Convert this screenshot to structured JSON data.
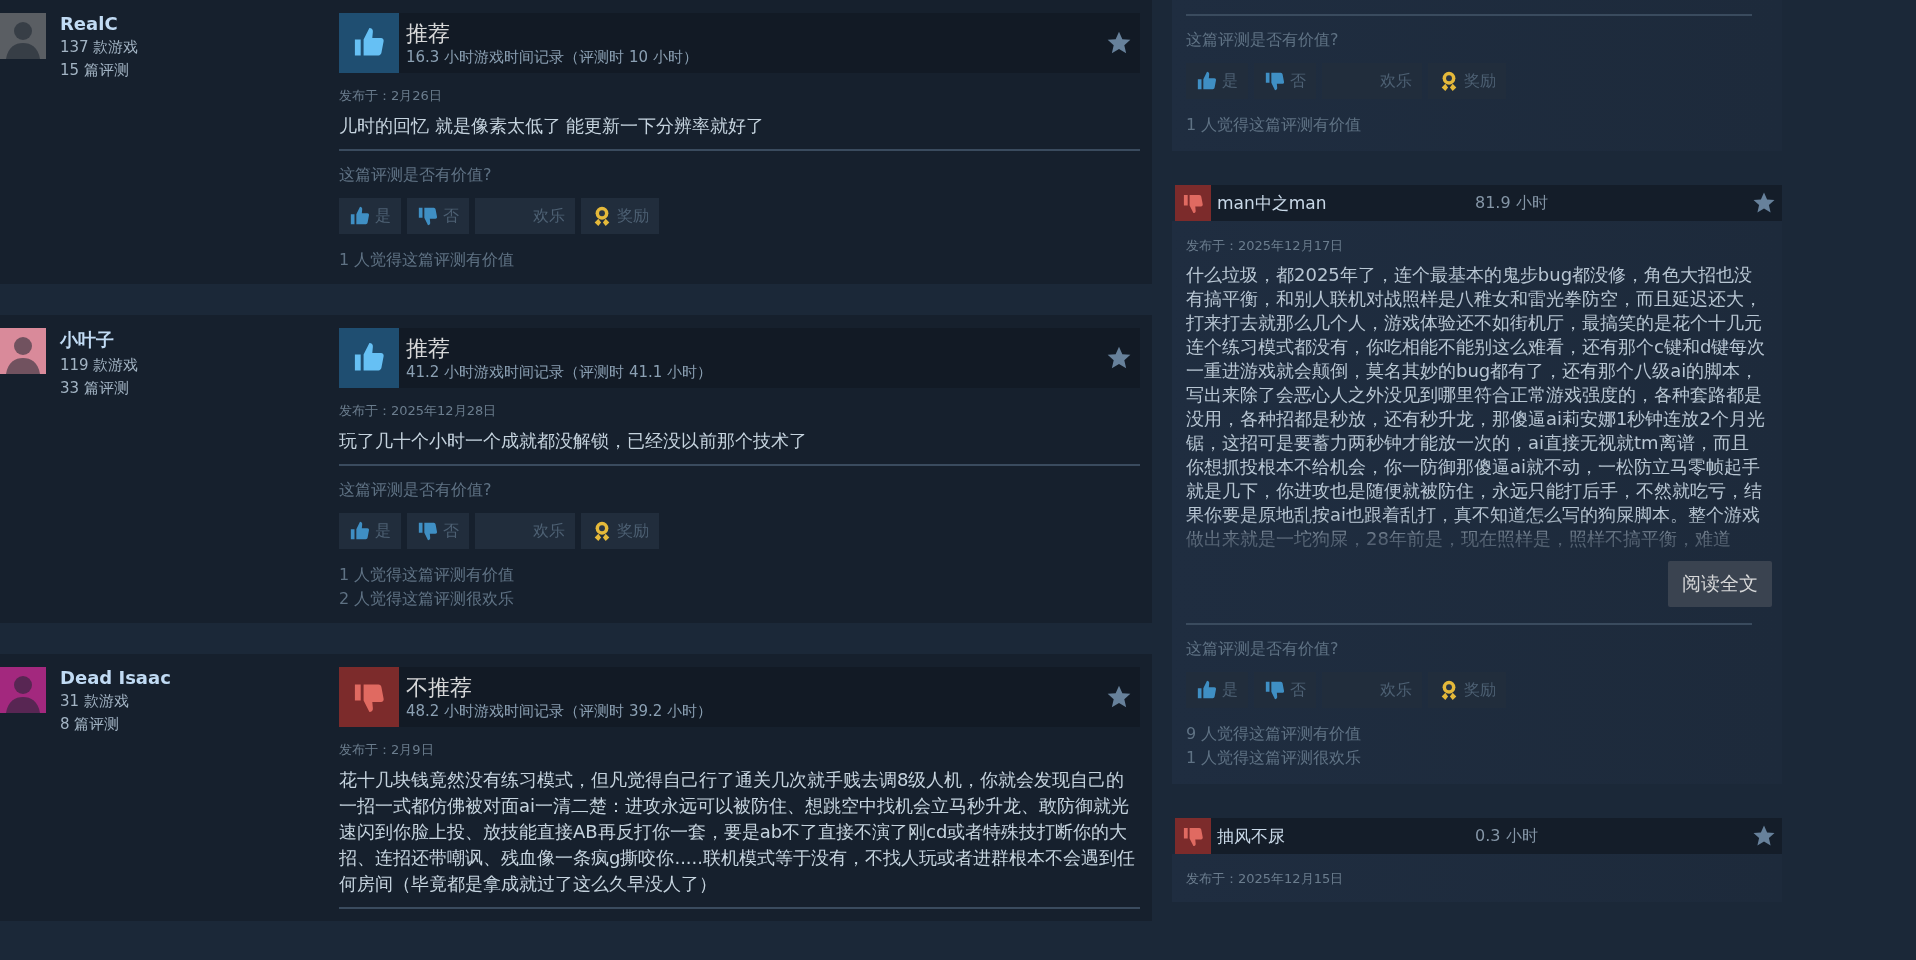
{
  "left_reviews": [
    {
      "user": {
        "name": "RealC",
        "games": "137 款游戏",
        "reviews": "15 篇评测",
        "color": "#5a5e63"
      },
      "recommended": true,
      "verdict": "推荐",
      "hours": "16.3 小时游戏时间记录（评测时 10 小时）",
      "posted": "发布于：2月26日",
      "body": "儿时的回忆 就是像素太低了 能更新一下分辨率就好了",
      "question": "这篇评测是否有价值?",
      "buttons": [
        {
          "kind": "yes",
          "label": "是"
        },
        {
          "kind": "no",
          "label": "否"
        },
        {
          "kind": "funny",
          "label": "欢乐"
        },
        {
          "kind": "award",
          "label": "奖励"
        }
      ],
      "counts": [
        "1 人觉得这篇评测有价值"
      ]
    },
    {
      "user": {
        "name": "小叶子",
        "games": "119 款游戏",
        "reviews": "33 篇评测",
        "color": "#d98a9a"
      },
      "recommended": true,
      "verdict": "推荐",
      "hours": "41.2 小时游戏时间记录（评测时 41.1 小时）",
      "posted": "发布于：2025年12月28日",
      "body": "玩了几十个小时一个成就都没解锁，已经没以前那个技术了",
      "question": "这篇评测是否有价值?",
      "buttons": [
        {
          "kind": "yes",
          "label": "是"
        },
        {
          "kind": "no",
          "label": "否"
        },
        {
          "kind": "funny",
          "label": "欢乐"
        },
        {
          "kind": "award",
          "label": "奖励"
        }
      ],
      "counts": [
        "1 人觉得这篇评测有价值",
        "2 人觉得这篇评测很欢乐"
      ]
    },
    {
      "user": {
        "name": "Dead Isaac",
        "games": "31 款游戏",
        "reviews": "8 篇评测",
        "color": "#a3287e"
      },
      "recommended": false,
      "verdict": "不推荐",
      "hours": "48.2 小时游戏时间记录（评测时 39.2 小时）",
      "posted": "发布于：2月9日",
      "body": "花十几块钱竟然没有练习模式，但凡觉得自己行了通关几次就手贱去调8级人机，你就会发现自己的一招一式都仿佛被对面ai一清二楚：进攻永远可以被防住、想跳空中找机会立马秒升龙、敢防御就光速闪到你脸上投、放技能直接AB再反打你一套，要是ab不了直接不演了刚cd或者特殊技打断你的大招、连招还带嘲讽、残血像一条疯g撕咬你.....联机模式等于没有，不找人玩或者进群根本不会遇到任何房间（毕竟都是拿成就过了这么久早没人了）"
    }
  ],
  "right_reviews": [
    {
      "question": "这篇评测是否有价值?",
      "buttons": [
        {
          "kind": "yes",
          "label": "是"
        },
        {
          "kind": "no",
          "label": "否"
        },
        {
          "kind": "funny",
          "label": "欢乐"
        },
        {
          "kind": "award",
          "label": "奖励"
        }
      ],
      "counts": [
        "1 人觉得这篇评测有价值"
      ]
    },
    {
      "recommended": false,
      "name": "man中之man",
      "hours": "81.9 小时",
      "posted": "发布于：2025年12月17日",
      "body": "什么垃圾，都2025年了，连个最基本的鬼步bug都没修，角色大招也没有搞平衡，和别人联机对战照样是八稚女和雷光拳防空，而且延迟还大，打来打去就那么几个人，游戏体验还不如街机厅，最搞笑的是花个十几元连个练习模式都没有，你吃相能不能别这么难看，还有那个c键和d键每次一重进游戏就会颠倒，莫名其妙的bug都有了，还有那个八级ai的脚本，写出来除了会恶心人之外没见到哪里符合正常游戏强度的，各种套路都是没用，各种招都是秒放，还有秒升龙，那傻逼ai莉安娜1秒钟连放2个月光锯，这招可是要蓄力两秒钟才能放一次的，ai直接无视就tm离谱，而且你想抓投根本不给机会，你一防御那傻逼ai就不动，一松防立马零帧起手就是几下，你进攻也是随便就被防住，永远只能打后手，不然就吃亏，结果你要是原地乱按ai也跟着乱打，真不知道怎么写的狗屎脚本。整个游戏做出来就是一坨狗屎，28年前是，现在照样是，照样不搞平衡，难道",
      "read_more": "阅读全文",
      "question": "这篇评测是否有价值?",
      "buttons": [
        {
          "kind": "yes",
          "label": "是"
        },
        {
          "kind": "no",
          "label": "否"
        },
        {
          "kind": "funny",
          "label": "欢乐"
        },
        {
          "kind": "award",
          "label": "奖励"
        }
      ],
      "counts": [
        "9 人觉得这篇评测有价值",
        "1 人觉得这篇评测很欢乐"
      ]
    },
    {
      "recommended": false,
      "name": "抽风不尿",
      "hours": "0.3 小时",
      "posted": "发布于：2025年12月15日"
    }
  ]
}
